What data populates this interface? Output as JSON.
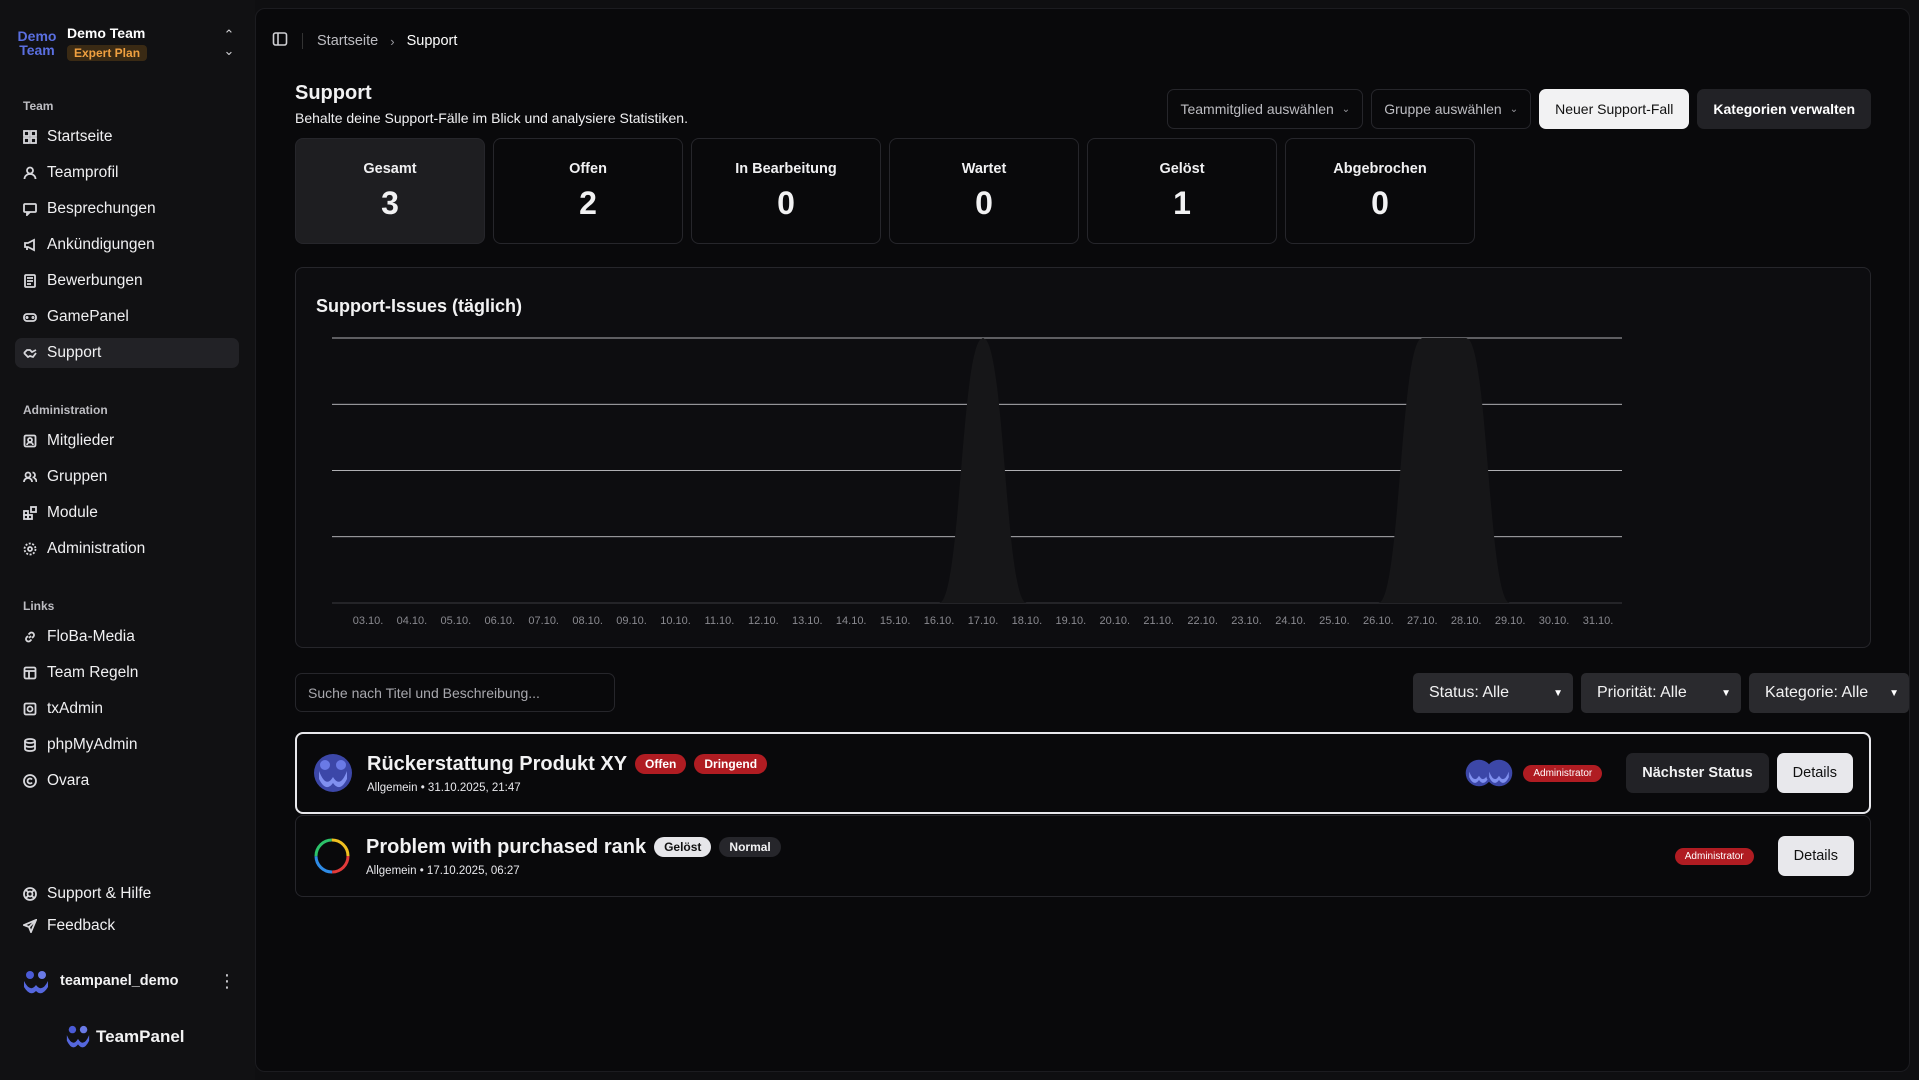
{
  "team": {
    "logo_text_1": "Demo",
    "logo_text_2": "Team",
    "name": "Demo Team",
    "plan": "Expert Plan"
  },
  "sidebar": {
    "team_label": "Team",
    "team_items": [
      {
        "label": "Startseite",
        "icon": "dashboard-icon"
      },
      {
        "label": "Teamprofil",
        "icon": "user-icon"
      },
      {
        "label": "Besprechungen",
        "icon": "message-icon"
      },
      {
        "label": "Ankündigungen",
        "icon": "megaphone-icon"
      },
      {
        "label": "Bewerbungen",
        "icon": "application-icon"
      },
      {
        "label": "GamePanel",
        "icon": "gamepad-icon"
      },
      {
        "label": "Support",
        "icon": "handshake-icon",
        "active": true
      }
    ],
    "admin_label": "Administration",
    "admin_items": [
      {
        "label": "Mitglieder",
        "icon": "contact-icon"
      },
      {
        "label": "Gruppen",
        "icon": "users-icon"
      },
      {
        "label": "Module",
        "icon": "blocks-icon"
      },
      {
        "label": "Administration",
        "icon": "gear-icon"
      }
    ],
    "links_label": "Links",
    "link_items": [
      {
        "label": "FloBa-Media",
        "icon": "link-icon"
      },
      {
        "label": "Team Regeln",
        "icon": "rules-icon"
      },
      {
        "label": "txAdmin",
        "icon": "terminal-icon"
      },
      {
        "label": "phpMyAdmin",
        "icon": "database-icon"
      },
      {
        "label": "Ovara",
        "icon": "copyright-icon"
      }
    ],
    "footer_items": [
      {
        "label": "Support & Hilfe",
        "icon": "lifebuoy-icon"
      },
      {
        "label": "Feedback",
        "icon": "send-icon"
      }
    ],
    "user": "teampanel_demo",
    "brand": "TeamPanel"
  },
  "breadcrumb": {
    "home": "Startseite",
    "current": "Support"
  },
  "header": {
    "title": "Support",
    "subtitle": "Behalte deine Support-Fälle im Blick und analysiere Statistiken.",
    "member_select": "Teammitglied auswählen",
    "group_select": "Gruppe auswählen",
    "new_case": "Neuer Support-Fall",
    "manage_categories": "Kategorien verwalten"
  },
  "stats": [
    {
      "label": "Gesamt",
      "value": "3"
    },
    {
      "label": "Offen",
      "value": "2"
    },
    {
      "label": "In Bearbeitung",
      "value": "0"
    },
    {
      "label": "Wartet",
      "value": "0"
    },
    {
      "label": "Gelöst",
      "value": "1"
    },
    {
      "label": "Abgebrochen",
      "value": "0"
    }
  ],
  "chart_data": {
    "type": "area",
    "title": "Support-Issues (täglich)",
    "x": [
      "03.10.",
      "04.10.",
      "05.10.",
      "06.10.",
      "07.10.",
      "08.10.",
      "09.10.",
      "10.10.",
      "11.10.",
      "12.10.",
      "13.10.",
      "14.10.",
      "15.10.",
      "16.10.",
      "17.10.",
      "18.10.",
      "19.10.",
      "20.10.",
      "21.10.",
      "22.10.",
      "23.10.",
      "24.10.",
      "25.10.",
      "26.10.",
      "27.10.",
      "28.10.",
      "29.10.",
      "30.10.",
      "31.10."
    ],
    "series": [
      {
        "values": [
          0,
          0,
          0,
          0,
          0,
          0,
          0,
          0,
          0,
          0,
          0,
          0,
          0,
          0,
          1,
          0,
          0,
          0,
          0,
          0,
          0,
          0,
          0,
          0,
          1,
          1,
          0,
          0,
          0
        ]
      }
    ],
    "ylim": [
      0,
      1
    ],
    "grid": true,
    "colors": {
      "fill": "#161618",
      "grid": "#e6e6ea",
      "tick": "#8a8a90"
    }
  },
  "filters": {
    "search_placeholder": "Suche nach Titel und Beschreibung...",
    "status": "Status: Alle",
    "priority": "Priorität: Alle",
    "category": "Kategorie: Alle"
  },
  "issues": [
    {
      "title": "Rückerstattung Produkt XY",
      "badges": [
        "Offen",
        "Dringend"
      ],
      "category": "Allgemein",
      "date": "31.10.2025, 21:47",
      "role": "Administrator",
      "next_label": "Nächster Status",
      "details_label": "Details"
    },
    {
      "title": "Problem with purchased rank",
      "badges": [
        "Gelöst",
        "Normal"
      ],
      "category": "Allgemein",
      "date": "17.10.2025, 06:27",
      "role": "Administrator",
      "details_label": "Details"
    }
  ]
}
